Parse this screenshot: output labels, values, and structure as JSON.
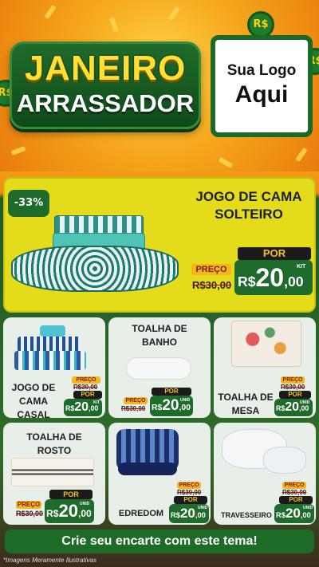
{
  "header": {
    "title_line1": "JANEIRO",
    "title_line2": "ARRASSADOR",
    "logo_line1": "Sua Logo",
    "logo_line2": "Aqui",
    "coin_label": "R$"
  },
  "featured": {
    "discount": "-33%",
    "title_line1": "JOGO DE CAMA",
    "title_line2": "SOLTEIRO",
    "preco_label": "PREÇO",
    "old_price": "R$30,00",
    "por_label": "POR",
    "currency": "R$",
    "price_int": "20",
    "price_dec": ",00",
    "unit": "KIT"
  },
  "products": [
    {
      "title": "JOGO DE CAMA CASAL",
      "preco_label": "PREÇO",
      "old_price": "R$30,00",
      "por_label": "POR",
      "currency": "R$",
      "price_int": "20",
      "price_dec": ",00",
      "unit": "KIT"
    },
    {
      "title": "TOALHA DE BANHO",
      "preco_label": "PREÇO",
      "old_price": "R$30,00",
      "por_label": "POR",
      "currency": "R$",
      "price_int": "20",
      "price_dec": ",00",
      "unit": "UNID"
    },
    {
      "title": "TOALHA DE MESA",
      "preco_label": "PREÇO",
      "old_price": "R$30,00",
      "por_label": "POR",
      "currency": "R$",
      "price_int": "20",
      "price_dec": ",00",
      "unit": "UNID"
    },
    {
      "title": "TOALHA DE ROSTO",
      "preco_label": "PREÇO",
      "old_price": "R$30,00",
      "por_label": "POR",
      "currency": "R$",
      "price_int": "20",
      "price_dec": ",00",
      "unit": "UNID"
    },
    {
      "title": "EDREDOM",
      "preco_label": "PREÇO",
      "old_price": "R$30,00",
      "por_label": "POR",
      "currency": "R$",
      "price_int": "20",
      "price_dec": ",00",
      "unit": "UNID"
    },
    {
      "title": "TRAVESSEIRO",
      "preco_label": "PREÇO",
      "old_price": "R$30,00",
      "por_label": "POR",
      "currency": "R$",
      "price_int": "20",
      "price_dec": ",00",
      "unit": "UNID"
    }
  ],
  "cta": "Crie seu encarte com este tema!",
  "footnote": "*Imagens Meramente Ilustrativas",
  "colors": {
    "brand_green": "#1e6b2b",
    "accent_yellow": "#f4b61d",
    "feature_bg": "#e4dc1a",
    "header_orange": "#f6a81d"
  }
}
